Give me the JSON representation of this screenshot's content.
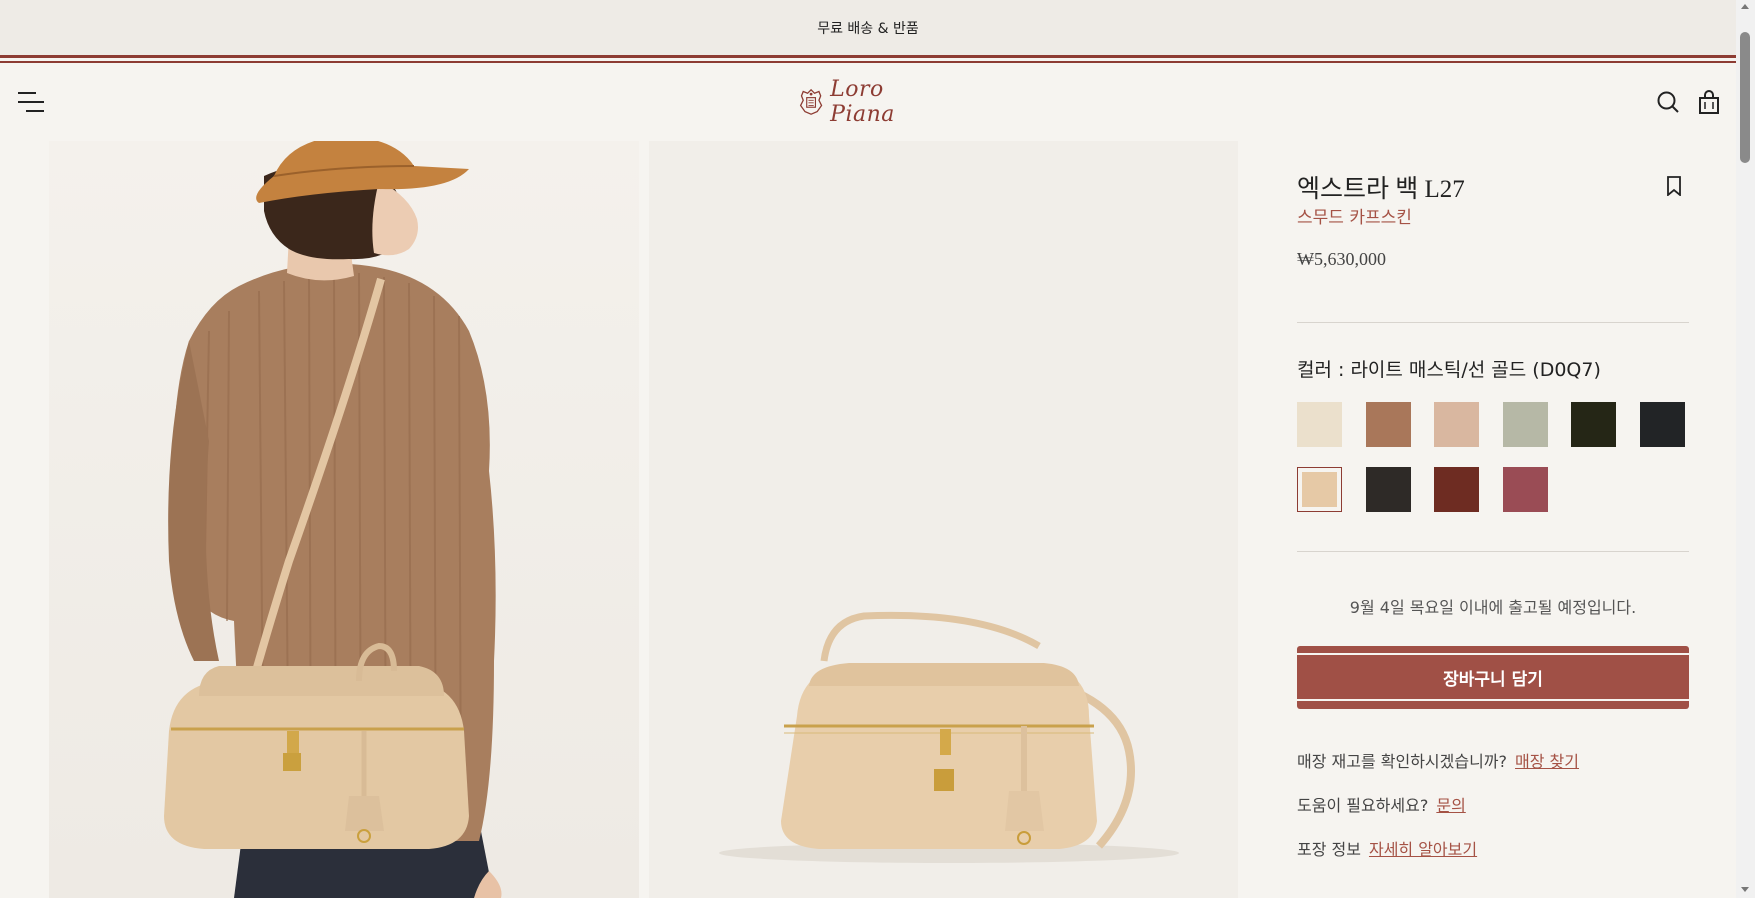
{
  "promo": {
    "text": "무료 배송 & 반품"
  },
  "header": {
    "logo_text": "Loro Piana",
    "menu_icon": "hamburger-menu-icon",
    "search_icon": "search-icon",
    "bag_icon": "shopping-bag-icon"
  },
  "product": {
    "title": "엑스트라 백 L27",
    "material": "스무드 카프스킨",
    "price": "₩5,630,000",
    "color_label": "컬러 : 라이트 매스틱/선 골드 (D0Q7)",
    "swatches": [
      {
        "color": "#ebe0cc",
        "selected": false
      },
      {
        "color": "#a9775a",
        "selected": false
      },
      {
        "color": "#d9b7a0",
        "selected": false
      },
      {
        "color": "#b6b8a6",
        "selected": false
      },
      {
        "color": "#252616",
        "selected": false
      },
      {
        "color": "#222426",
        "selected": false
      },
      {
        "color": "#e6c9a6",
        "selected": true
      },
      {
        "color": "#2e2a27",
        "selected": false
      },
      {
        "color": "#6e2c22",
        "selected": false
      },
      {
        "color": "#9a4c55",
        "selected": false
      }
    ],
    "shipping_note": "9월 4일 목요일 이내에 출고될 예정입니다.",
    "add_to_cart": "장바구니 담기",
    "store_stock_q": "매장 재고를 확인하시겠습니까?",
    "store_stock_link": "매장 찾기",
    "help_q": "도움이 필요하세요?",
    "help_link": "문의",
    "packaging_q": "포장 정보",
    "packaging_link": "자세히 알아보기"
  },
  "colors": {
    "brand": "#8d3c33",
    "cart_button": "#a05046",
    "link": "#a55245"
  }
}
